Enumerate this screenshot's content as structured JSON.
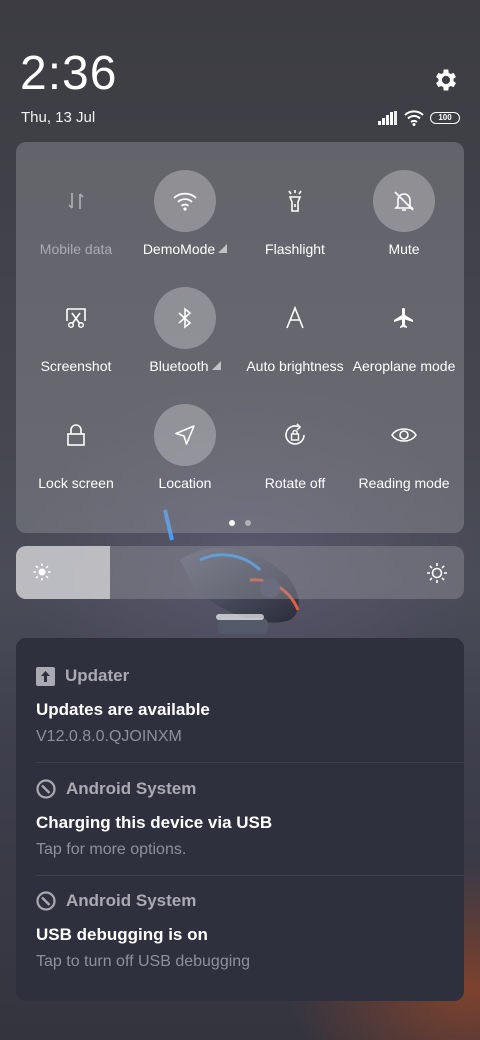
{
  "status_bar": {
    "time": "2:36",
    "date": "Thu, 13 Jul",
    "battery_level": "100",
    "icons": [
      "signal-icon",
      "wifi-icon",
      "battery-icon"
    ]
  },
  "settings": {
    "icon": "gear-icon"
  },
  "quick_settings": {
    "tiles": [
      {
        "label": "Mobile data",
        "icon": "mobile-data-icon",
        "active": false,
        "dimmed": true,
        "expandable": false
      },
      {
        "label": "DemoMode",
        "icon": "wifi-icon",
        "active": true,
        "dimmed": false,
        "expandable": true
      },
      {
        "label": "Flashlight",
        "icon": "flashlight-icon",
        "active": false,
        "dimmed": false,
        "expandable": false
      },
      {
        "label": "Mute",
        "icon": "bell-off-icon",
        "active": true,
        "dimmed": false,
        "expandable": false
      },
      {
        "label": "Screenshot",
        "icon": "screenshot-icon",
        "active": false,
        "dimmed": false,
        "expandable": false
      },
      {
        "label": "Bluetooth",
        "icon": "bluetooth-icon",
        "active": true,
        "dimmed": false,
        "expandable": true
      },
      {
        "label": "Auto brightness",
        "icon": "auto-brightness-icon",
        "active": false,
        "dimmed": false,
        "expandable": false
      },
      {
        "label": "Aeroplane mode",
        "icon": "airplane-icon",
        "active": false,
        "dimmed": false,
        "expandable": false
      },
      {
        "label": "Lock screen",
        "icon": "lock-icon",
        "active": false,
        "dimmed": false,
        "expandable": false
      },
      {
        "label": "Location",
        "icon": "location-icon",
        "active": true,
        "dimmed": false,
        "expandable": false
      },
      {
        "label": "Rotate off",
        "icon": "rotate-lock-icon",
        "active": false,
        "dimmed": false,
        "expandable": false
      },
      {
        "label": "Reading mode",
        "icon": "eye-icon",
        "active": false,
        "dimmed": false,
        "expandable": false
      }
    ],
    "page_count": 2,
    "current_page": 1
  },
  "brightness": {
    "level": 0.21,
    "icon_low": "sun-small-icon",
    "icon_high": "sun-large-icon"
  },
  "notifications": [
    {
      "app": "Updater",
      "app_icon": "updater-icon",
      "title": "Updates are available",
      "body": "V12.0.8.0.QJOINXM"
    },
    {
      "app": "Android System",
      "app_icon": "android-system-icon",
      "title": "Charging this device via USB",
      "body": "Tap for more options."
    },
    {
      "app": "Android System",
      "app_icon": "android-system-icon",
      "title": "USB debugging is on",
      "body": "Tap to turn off USB debugging"
    }
  ]
}
